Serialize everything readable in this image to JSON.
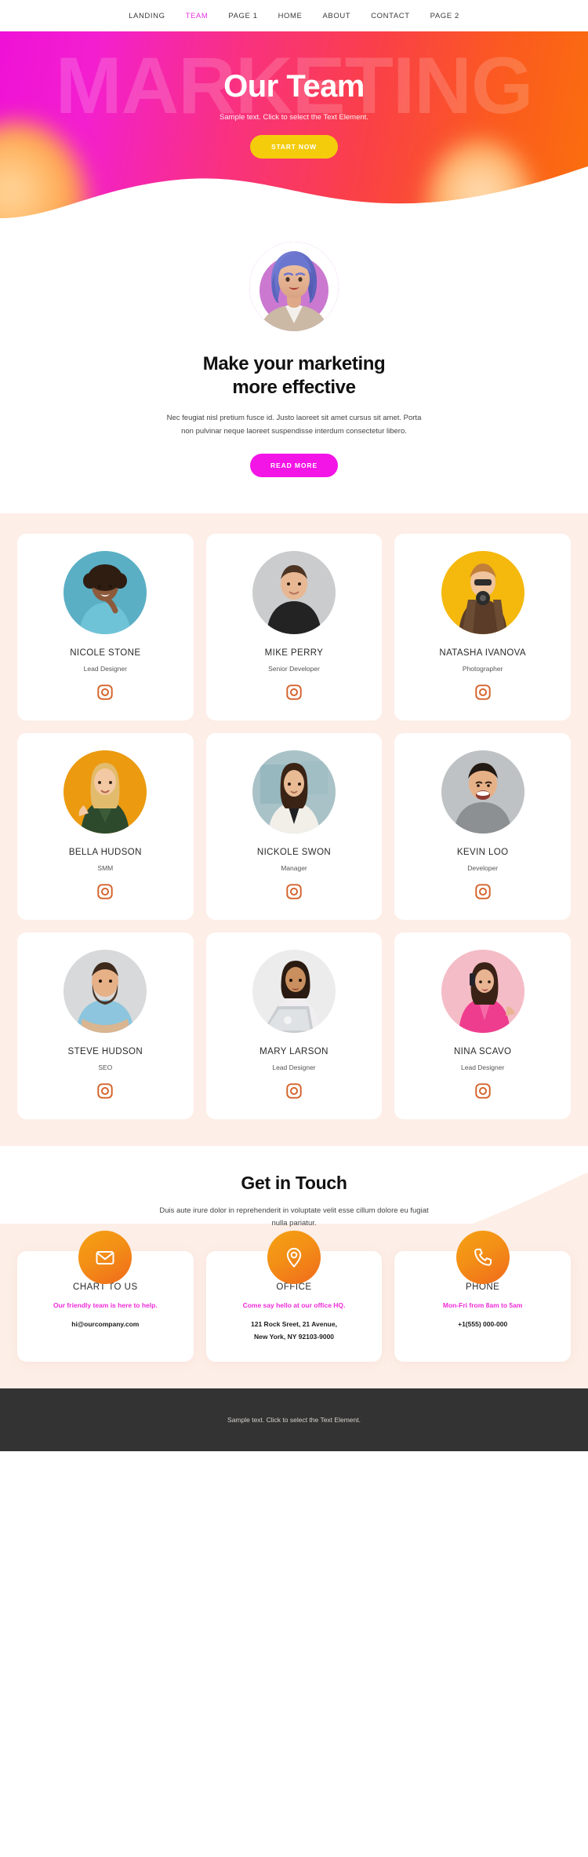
{
  "nav": {
    "items": [
      {
        "label": "LANDING",
        "active": false
      },
      {
        "label": "TEAM",
        "active": true
      },
      {
        "label": "PAGE 1",
        "active": false
      },
      {
        "label": "HOME",
        "active": false
      },
      {
        "label": "ABOUT",
        "active": false
      },
      {
        "label": "CONTACT",
        "active": false
      },
      {
        "label": "PAGE 2",
        "active": false
      }
    ],
    "active_color": "#e832e0"
  },
  "hero": {
    "watermark": "MARKETING",
    "title": "Our Team",
    "subtitle": "Sample text. Click to select the Text Element.",
    "button_label": "START NOW",
    "button_color": "#f5cc0b",
    "gradient_from": "#ef11d6",
    "gradient_to": "#fb6f0c"
  },
  "intro": {
    "avatar_icon": "woman-avatar-blue-hair",
    "heading_line1": "Make your marketing",
    "heading_line2": "more effective",
    "paragraph": "Nec feugiat nisl pretium fusce id. Justo laoreet sit amet cursus sit amet. Porta non pulvinar neque laoreet suspendisse interdum consectetur libero.",
    "button_label": "READ MORE",
    "button_color": "#f215e6"
  },
  "team": {
    "background": "#fdeee7",
    "social_icon": "instagram-icon",
    "social_icon_color": "#d4622a",
    "members": [
      {
        "name": "NICOLE STONE",
        "role": "Lead Designer",
        "photo": "woman-curly-hair-teal-background",
        "bg": "#5aafc4"
      },
      {
        "name": "MIKE PERRY",
        "role": "Senior Developer",
        "photo": "man-black-tshirt-grey-background",
        "bg": "#c9cacb"
      },
      {
        "name": "NATASHA IVANOVA",
        "role": "Photographer",
        "photo": "woman-camera-yellow-background",
        "bg": "#f5b80d"
      },
      {
        "name": "BELLA HUDSON",
        "role": "SMM",
        "photo": "woman-green-jacket-orange-background",
        "bg": "#ec9a10"
      },
      {
        "name": "NICKOLE SWON",
        "role": "Manager",
        "photo": "woman-white-blazer-office-background",
        "bg": "#9fb9bd"
      },
      {
        "name": "KEVIN LOO",
        "role": "Developer",
        "photo": "man-grey-shirt-grey-background",
        "bg": "#b9bcbe"
      },
      {
        "name": "STEVE HUDSON",
        "role": "SEO",
        "photo": "bearded-man-blue-shirt-grey-background",
        "bg": "#d5d7d8"
      },
      {
        "name": "MARY LARSON",
        "role": "Lead Designer",
        "photo": "woman-with-laptop-white-background",
        "bg": "#e6e6e6"
      },
      {
        "name": "NINA SCAVO",
        "role": "Lead Designer",
        "photo": "woman-pink-jacket-phone-pink-background",
        "bg": "#f4bcc6"
      }
    ]
  },
  "contact": {
    "heading": "Get in Touch",
    "paragraph": "Duis aute irure dolor in reprehenderit in voluptate velit esse cillum dolore eu fugiat nulla pariatur.",
    "accent_color": "#ee2bd8",
    "icon_gradient_from": "#f5a113",
    "icon_gradient_to": "#f06a1c",
    "cards": [
      {
        "icon": "envelope-icon",
        "title": "CHART TO US",
        "subtitle": "Our friendly team is here to help.",
        "value_line1": "hi@ourcompany.com",
        "value_line2": ""
      },
      {
        "icon": "map-pin-icon",
        "title": "OFFICE",
        "subtitle": "Come say hello at our office HQ.",
        "value_line1": "121 Rock Sreet, 21 Avenue,",
        "value_line2": "New York, NY 92103-9000"
      },
      {
        "icon": "phone-icon",
        "title": "PHONE",
        "subtitle": "Mon-Fri from 8am to 5am",
        "value_line1": "+1(555) 000-000",
        "value_line2": ""
      }
    ]
  },
  "footer": {
    "text": "Sample text. Click to select the Text Element.",
    "background": "#333333"
  }
}
